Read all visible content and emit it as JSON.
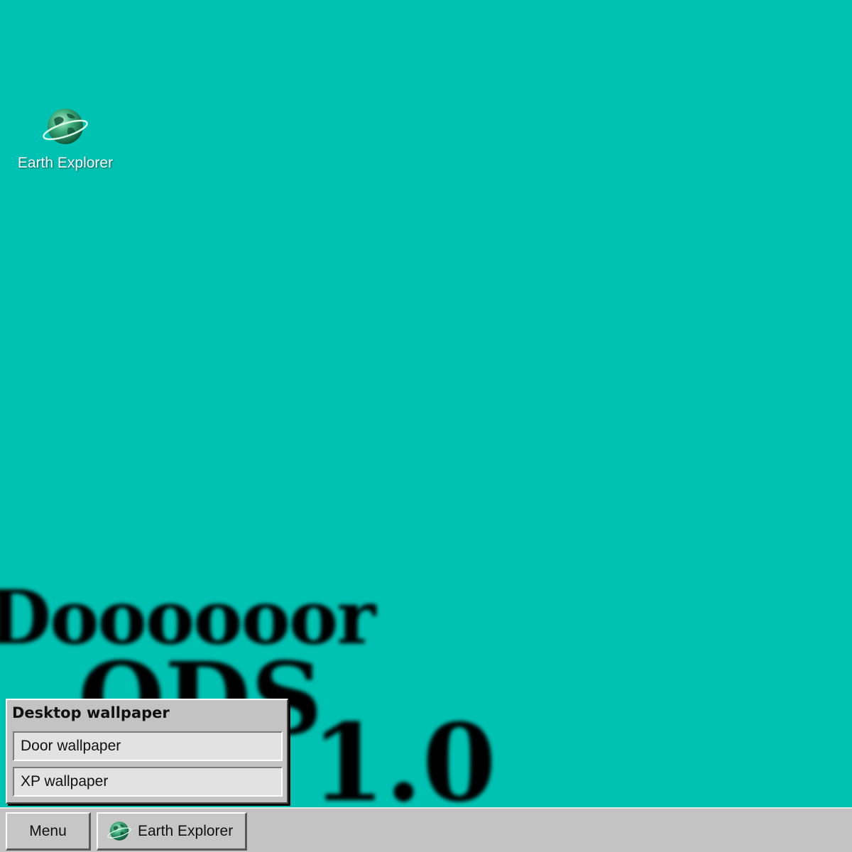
{
  "wallpaper": {
    "line1": "Doooooor",
    "line2": "ODS",
    "line3": "1.0"
  },
  "desktop_icons": [
    {
      "label": "Earth Explorer",
      "icon": "earth-globe-icon"
    }
  ],
  "popup_menu": {
    "title": "Desktop wallpaper",
    "items": [
      {
        "label": "Door wallpaper"
      },
      {
        "label": "XP wallpaper"
      }
    ]
  },
  "taskbar": {
    "menu_label": "Menu",
    "apps": [
      {
        "label": "Earth Explorer",
        "icon": "earth-globe-icon"
      }
    ]
  },
  "colors": {
    "desktop_background": "#00c2b2",
    "taskbar_background": "#c3c3c3",
    "menu_item_background": "#e2e2e2"
  }
}
